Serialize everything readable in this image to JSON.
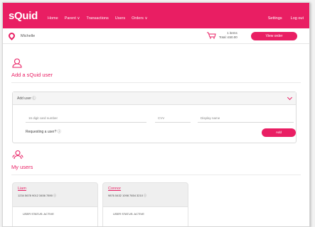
{
  "brand": {
    "logo": "sQuid",
    "accent": "#e91e63"
  },
  "nav": {
    "items": [
      "Home",
      "Parent ∨",
      "Transactions",
      "Users",
      "Orders ∨"
    ],
    "right": [
      "Settings",
      "Log out"
    ]
  },
  "profile_bar": {
    "name": "Michelle",
    "basket_line1": "1 items",
    "basket_line2": "Total: £50.00",
    "view_button": "View order"
  },
  "add_user": {
    "title": "Add a sQuid user",
    "card_label": "Add user ⓘ",
    "placeholders": {
      "card": "16 digit card number",
      "cvv": "CVV",
      "name": "Display name"
    },
    "requesting": "Requesting a user? ⓘ",
    "add_button": "Add"
  },
  "my_users": {
    "title": "My users",
    "users": [
      {
        "name": "Liam",
        "card": "1234 5678 9012 3456 7890 ⓘ",
        "status": "USER STATUS: ACTIVE"
      },
      {
        "name": "Connor",
        "card": "9876 5432 1098 7654 3210 ⓘ",
        "status": "USER STATUS: ACTIVE"
      }
    ]
  }
}
